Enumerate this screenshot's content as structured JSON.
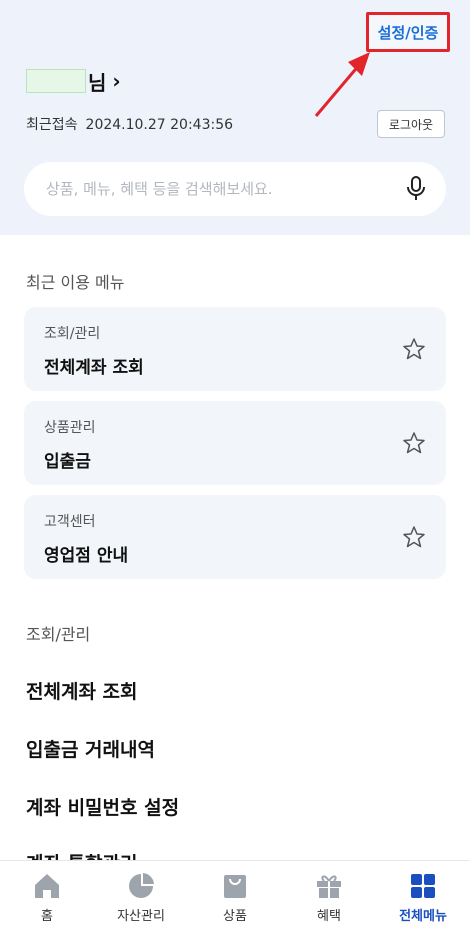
{
  "header": {
    "settings_label": "설정/인증",
    "user_suffix": "님",
    "chevron": "›",
    "last_login_label": "최근접속",
    "last_login_time": "2024.10.27 20:43:56",
    "logout_label": "로그아웃"
  },
  "search": {
    "placeholder": "상품, 메뉴, 혜택 등을 검색해보세요.",
    "mic_icon": "microphone-icon"
  },
  "recent": {
    "title": "최근 이용 메뉴",
    "items": [
      {
        "category": "조회/관리",
        "title": "전체계좌 조회"
      },
      {
        "category": "상품관리",
        "title": "입출금"
      },
      {
        "category": "고객센터",
        "title": "영업점 안내"
      }
    ]
  },
  "inquiry": {
    "title": "조회/관리",
    "items": [
      "전체계좌 조회",
      "입출금 거래내역",
      "계좌 비밀번호 설정",
      "계좌 통합관리"
    ]
  },
  "tabbar": {
    "items": [
      {
        "label": "홈",
        "icon": "home-icon"
      },
      {
        "label": "자산관리",
        "icon": "pie-chart-icon"
      },
      {
        "label": "상품",
        "icon": "shopping-bag-icon"
      },
      {
        "label": "혜택",
        "icon": "gift-icon"
      },
      {
        "label": "전체메뉴",
        "icon": "grid-menu-icon"
      }
    ],
    "active_index": 4
  },
  "colors": {
    "accent": "#1a6fd6",
    "highlight": "#e2242b",
    "active_tab": "#1a4fbf",
    "inactive_icon": "#9ea4ab"
  }
}
